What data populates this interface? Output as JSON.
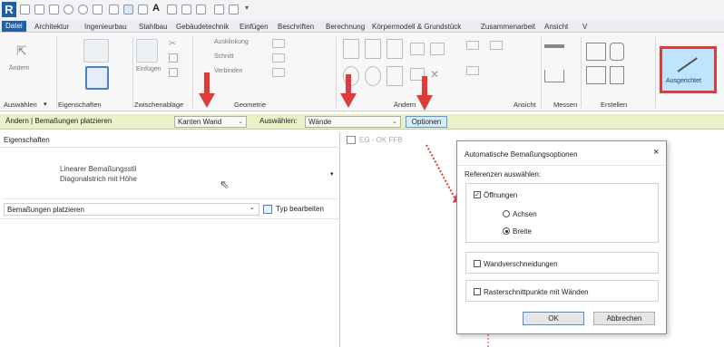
{
  "app": {
    "logo_letter": "R"
  },
  "ribbon_tabs": [
    {
      "label": "Datei"
    },
    {
      "label": "Architektur"
    },
    {
      "label": "Ingenieurbau"
    },
    {
      "label": "Stahlbau"
    },
    {
      "label": "Gebäudetechnik"
    },
    {
      "label": "Einfügen"
    },
    {
      "label": "Beschriften"
    },
    {
      "label": "Berechnung"
    },
    {
      "label": "Körpermodell & Grundstück"
    },
    {
      "label": "Zusammenarbeit"
    },
    {
      "label": "Ansicht"
    },
    {
      "label": "V"
    }
  ],
  "ribbon": {
    "aendern": "Ändern",
    "einfuegen": "Einfügen",
    "ausklinkung": "Ausklinkung",
    "schnitt": "Schnitt",
    "verbinden": "Verbinden",
    "ausgerichtet": "Ausgerichtet",
    "groups": {
      "auswaehlen": "Auswählen",
      "eigenschaften": "Eigenschaften",
      "zwischenablage": "Zwischenablage",
      "geometrie": "Geometrie",
      "aendern": "Ändern",
      "ansicht": "Ansicht",
      "messen": "Messen",
      "erstellen": "Erstellen"
    }
  },
  "options_bar": {
    "context": "Ändern | Bemaßungen platzieren",
    "reference_value": "Kanten Wand",
    "select_label": "Auswählen:",
    "select_value": "Wände",
    "options_button": "Optionen"
  },
  "properties": {
    "title": "Eigenschaften",
    "type_line1": "Linearer Bemaßungsstil",
    "type_line2": "Diagonalstrich mit Höhe",
    "instance_filter": "Bemaßungen platzieren",
    "edit_type": "Typ bearbeiten"
  },
  "view_tab": {
    "label": "EG - OK FFB"
  },
  "dialog": {
    "title": "Automatische Bemaßungsoptionen",
    "close": "×",
    "references_label": "Referenzen auswählen:",
    "openings": {
      "label": "Öffnungen",
      "checked": true
    },
    "axes": {
      "label": "Achsen",
      "selected": false
    },
    "width": {
      "label": "Breite",
      "selected": true
    },
    "wall_intersections": {
      "label": "Wandverschneidungen",
      "checked": false
    },
    "grid_intersections": {
      "label": "Rasterschnittpunkte mit Wänden",
      "checked": false
    },
    "ok": "OK",
    "cancel": "Abbrechen"
  },
  "colors": {
    "accent_red": "#e03a3a",
    "file_tab": "#1f5fa8",
    "options_bar": "#eaf0c8",
    "highlight": "#bfe4ff"
  }
}
